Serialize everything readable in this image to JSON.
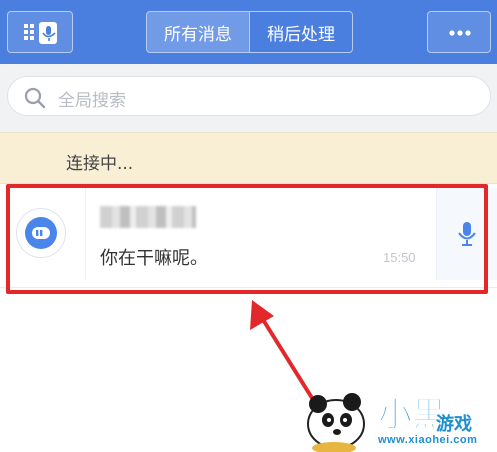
{
  "header": {
    "tabs": [
      {
        "label": "所有消息",
        "active": true
      },
      {
        "label": "稍后处理",
        "active": false
      }
    ],
    "left_button_icon": "qr-voice-icon",
    "right_button_icon": "more-dots-icon"
  },
  "search": {
    "placeholder": "全局搜索"
  },
  "connection": {
    "status": "连接中..."
  },
  "conversations": [
    {
      "name": "",
      "message": "你在干嘛呢。",
      "time": "15:50",
      "avatar_icon": "chat-bubble-icon",
      "action_icon": "microphone-icon"
    }
  ],
  "watermark": {
    "brand": "小黑游戏",
    "small": "游戏",
    "url": "www.xiaohei.com"
  },
  "colors": {
    "header_bg": "#4a7fe0",
    "highlight": "#e3282b",
    "connection_bg": "#f9efd5"
  }
}
